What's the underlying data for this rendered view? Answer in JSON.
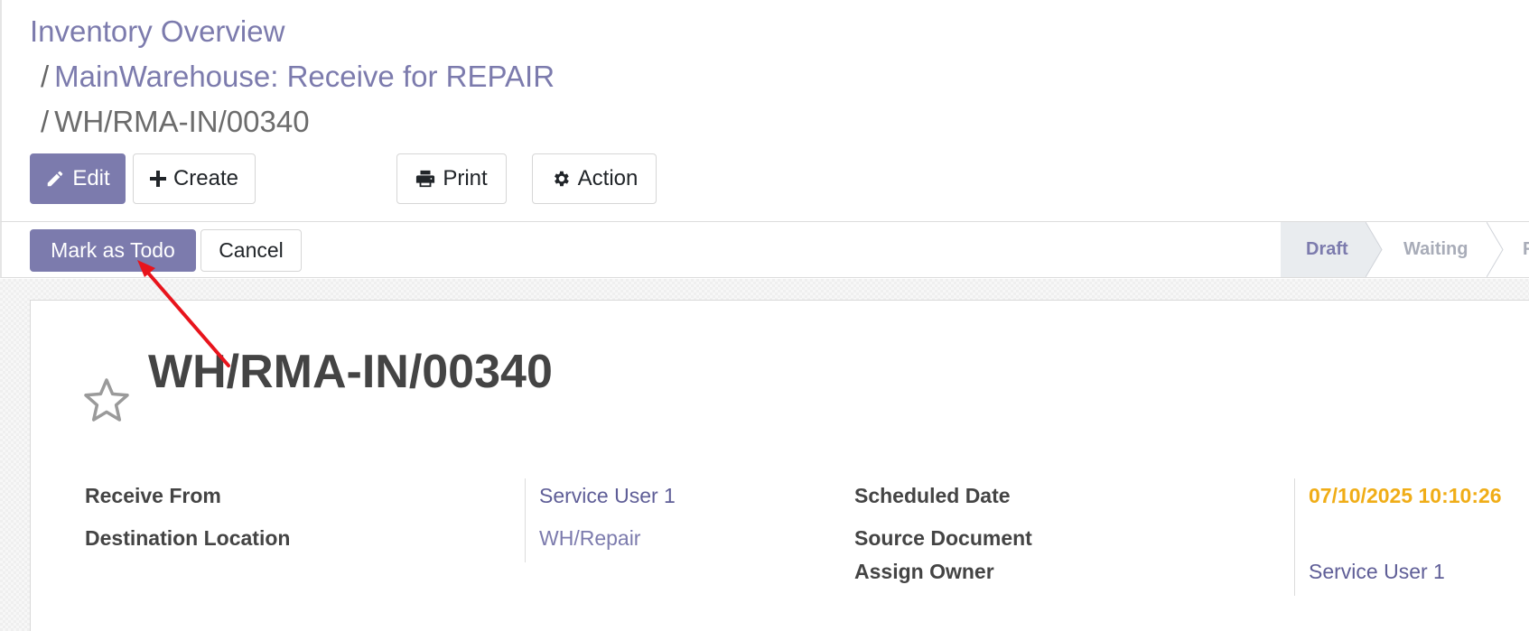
{
  "breadcrumb": {
    "root": "Inventory Overview",
    "separator": "/",
    "parent": "MainWarehouse: Receive for REPAIR",
    "current": "WH/RMA-IN/00340"
  },
  "toolbar": {
    "edit_label": "Edit",
    "create_label": "Create",
    "print_label": "Print",
    "action_label": "Action"
  },
  "statusbar": {
    "mark_todo_label": "Mark as Todo",
    "cancel_label": "Cancel",
    "stages": [
      "Draft",
      "Waiting",
      "F"
    ],
    "current_stage": "Draft"
  },
  "record": {
    "title": "WH/RMA-IN/00340",
    "fields": {
      "receive_from": {
        "label": "Receive From",
        "value": "Service User 1"
      },
      "destination_location": {
        "label": "Destination Location",
        "value": "WH/Repair"
      },
      "scheduled_date": {
        "label": "Scheduled Date",
        "value": "07/10/2025 10:10:26"
      },
      "source_document": {
        "label": "Source Document",
        "value": ""
      },
      "assign_owner": {
        "label": "Assign Owner",
        "value": "Service User 1"
      }
    }
  },
  "colors": {
    "primary": "#7c7bad",
    "warning_date": "#f0ad17",
    "annotation_arrow": "#e8141c"
  }
}
